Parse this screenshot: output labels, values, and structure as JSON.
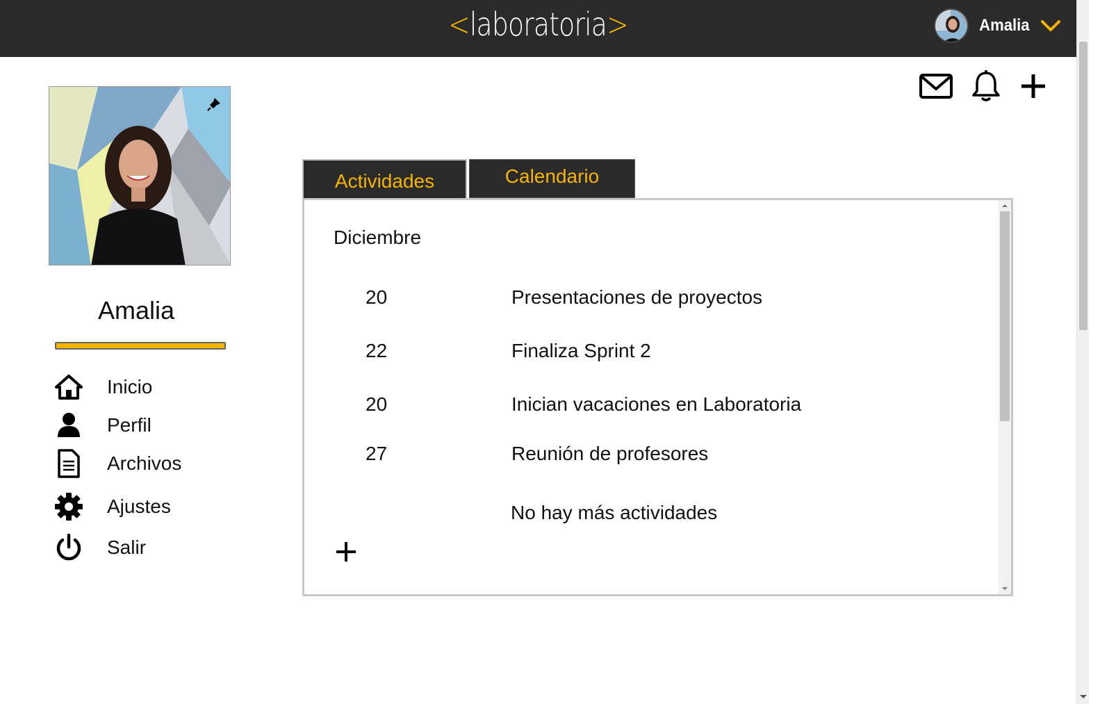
{
  "header": {
    "logo_open": "<",
    "logo_text": "laboratoria",
    "logo_close": ">",
    "user_name": "Amalia"
  },
  "top_actions": {
    "icons": [
      "mail-icon",
      "bell-icon",
      "plus-icon"
    ]
  },
  "profile": {
    "name": "Amalia",
    "progress": 1.0
  },
  "nav": {
    "items": [
      {
        "label": "Inicio",
        "icon": "home-icon"
      },
      {
        "label": "Perfil",
        "icon": "user-icon"
      },
      {
        "label": "Archivos",
        "icon": "document-icon"
      },
      {
        "label": "Ajustes",
        "icon": "gear-icon"
      },
      {
        "label": "Salir",
        "icon": "power-icon"
      }
    ]
  },
  "tabs": [
    {
      "label": "Actividades",
      "active": true
    },
    {
      "label": "Calendario",
      "active": false
    }
  ],
  "activities": {
    "month": "Diciembre",
    "items": [
      {
        "day": "20",
        "desc": "Presentaciones de proyectos"
      },
      {
        "day": "22",
        "desc": "Finaliza Sprint 2"
      },
      {
        "day": "20",
        "desc": "Inician vacaciones en Laboratoria"
      },
      {
        "day": "27",
        "desc": "Reunión de profesores"
      }
    ],
    "empty_message": "No hay más actividades"
  },
  "colors": {
    "accent": "#f5b400",
    "dark": "#2a2a2a"
  }
}
